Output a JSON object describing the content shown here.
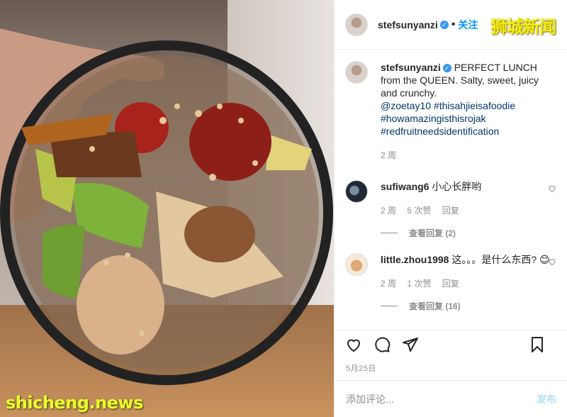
{
  "watermarks": {
    "site": "shicheng.news",
    "brand": "狮城新闻"
  },
  "header": {
    "username": "stefsunyanzi",
    "follow_label": "关注",
    "dot": "•"
  },
  "caption": {
    "username": "stefsunyanzi",
    "text": "PERFECT LUNCH from the QUEEN. Salty, sweet, juicy and crunchy.",
    "tags": [
      "@zoetay10 #thisahjieisafoodie",
      "#howamazingisthisrojak",
      "#redfruitneedsidentification"
    ],
    "time": "2 周"
  },
  "comments": [
    {
      "username": "sufiwang6",
      "text": "小心长胖哟",
      "time": "2 周",
      "likes": "5 次赞",
      "reply": "回复",
      "view_replies": "查看回复 (2)"
    },
    {
      "username": "little.zhou1998",
      "text": "这。。。是什么东西? 😊",
      "time": "2 周",
      "likes": "1 次赞",
      "reply": "回复",
      "view_replies": "查看回复 (16)"
    }
  ],
  "post_date": "5月25日",
  "add_comment": {
    "placeholder": "添加评论...",
    "post_label": "发布"
  },
  "icons": [
    "heart-icon",
    "comment-icon",
    "share-icon",
    "bookmark-icon",
    "verified-badge-icon"
  ]
}
